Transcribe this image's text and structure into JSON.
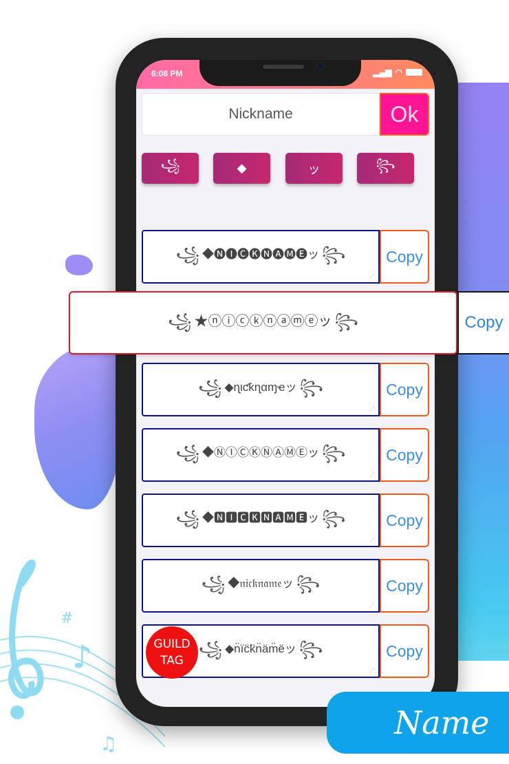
{
  "status_bar": {
    "time": "6:08 PM",
    "signal_icon": "signal-bars-icon",
    "wifi_icon": "wifi-icon",
    "battery_icon": "battery-icon"
  },
  "input": {
    "value": "Nickname",
    "ok_label": "Ok"
  },
  "symbol_buttons": [
    {
      "glyph": "꧁",
      "icon": "swirl-left-icon"
    },
    {
      "glyph": "◆",
      "icon": "diamond-icon"
    },
    {
      "glyph": "ッ",
      "icon": "tsu-icon"
    },
    {
      "glyph": "꧂",
      "icon": "swirl-right-icon"
    }
  ],
  "results": [
    {
      "text": "◆🅝🅘🅒🅚🅝🅐🅜🅔ッ",
      "copy_label": "Copy"
    },
    {
      "text": "◆ɳιƈƙɳαɱҽッ",
      "copy_label": "Copy"
    },
    {
      "text": "◆ⓃⒾⒸⓀⓃⒶⓂⒺッ",
      "copy_label": "Copy"
    },
    {
      "text": "◆🅽🅸🅲🅺🅽🅰🅼🅴ッ",
      "copy_label": "Copy"
    },
    {
      "text": "◆𝔫𝔦𝔠𝔨𝔫𝔞𝔪𝔢ッ",
      "copy_label": "Copy"
    },
    {
      "text": "◆n̈ïc̈k̈n̈äm̈ëッ",
      "copy_label": "Copy"
    }
  ],
  "highlighted": {
    "text": "★ⓝⓘⓒⓚⓝⓐⓜⓔッ",
    "copy_label": "Copy"
  },
  "ornaments": {
    "left": "꧁",
    "right": "꧂"
  },
  "guild_tag": {
    "line1": "GUILD",
    "line2": "TAG"
  },
  "banner": {
    "label": "Name"
  },
  "colors": {
    "ok_button": "#ff1493",
    "symbol_button": "#b8286f",
    "result_border": "#0c1386",
    "copy_border": "#f05a1d",
    "copy_text": "#3a8ee6",
    "highlight_border": "#d8202a",
    "guild_tag": "#ee1111",
    "banner": "#0fa3ec"
  }
}
